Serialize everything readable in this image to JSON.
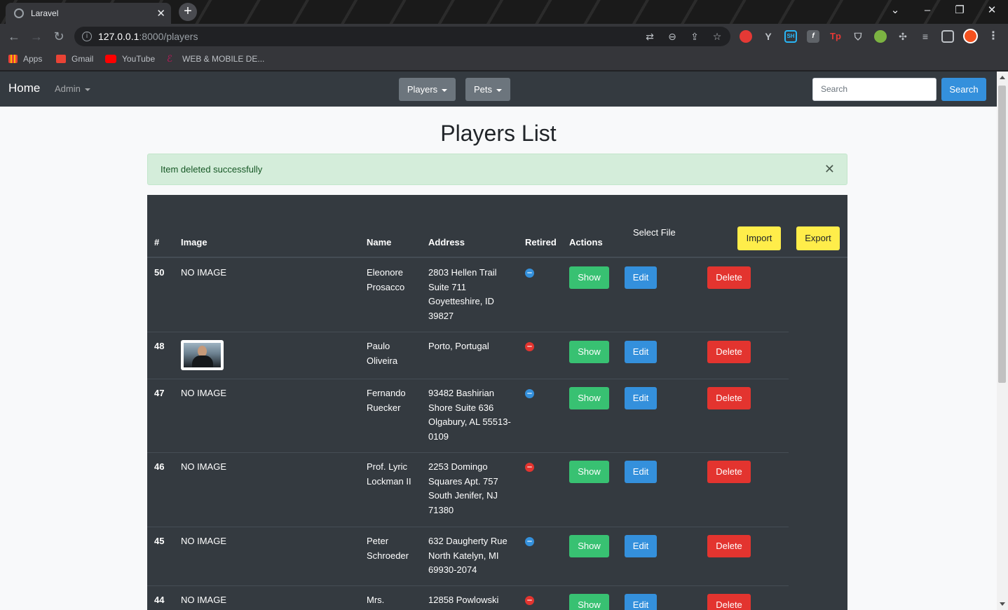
{
  "browser": {
    "tab_title": "Laravel",
    "tab_close": "✕",
    "new_tab": "+",
    "url_host": "127.0.0.1",
    "url_path": ":8000/players",
    "bookmarks": [
      "Apps",
      "Gmail",
      "YouTube",
      "WEB & MOBILE DE..."
    ]
  },
  "navbar": {
    "brand": "Home",
    "admin": "Admin",
    "players": "Players",
    "pets": "Pets",
    "search_placeholder": "Search",
    "search_button": "Search"
  },
  "page": {
    "title": "Players List",
    "alert": "Item deleted successfully",
    "alert_close": "✕"
  },
  "table": {
    "headers": {
      "id": "#",
      "image": "Image",
      "name": "Name",
      "address": "Address",
      "retired": "Retired",
      "actions": "Actions"
    },
    "select_file": "Select File",
    "import": "Import",
    "export": "Export",
    "actions": {
      "show": "Show",
      "edit": "Edit",
      "delete": "Delete"
    },
    "rows": [
      {
        "id": "50",
        "image": "NO IMAGE",
        "name": "Eleonore Prosacco",
        "address": "2803 Hellen Trail Suite 711 Goyetteshire, ID 39827",
        "retired": "blue"
      },
      {
        "id": "48",
        "image": "",
        "name": "Paulo Oliveira",
        "address": "Porto, Portugal",
        "retired": "red"
      },
      {
        "id": "47",
        "image": "NO IMAGE",
        "name": "Fernando Ruecker",
        "address": "93482 Bashirian Shore Suite 636 Olgabury, AL 55513-0109",
        "retired": "blue"
      },
      {
        "id": "46",
        "image": "NO IMAGE",
        "name": "Prof. Lyric Lockman II",
        "address": "2253 Domingo Squares Apt. 757 South Jenifer, NJ 71380",
        "retired": "red"
      },
      {
        "id": "45",
        "image": "NO IMAGE",
        "name": "Peter Schroeder",
        "address": "632 Daugherty Rue North Katelyn, MI 69930-2074",
        "retired": "blue"
      },
      {
        "id": "44",
        "image": "NO IMAGE",
        "name": "Mrs.",
        "address": "12858 Powlowski",
        "retired": "red"
      }
    ]
  },
  "colors": {
    "navbar": "#343a40",
    "table": "#343a40",
    "show": "#38c172",
    "edit": "#3490dc",
    "delete": "#e3342f",
    "import_export": "#ffed4a",
    "alert_bg": "#d4edda",
    "retired_yes": "#e3342f",
    "retired_no": "#3490dc"
  },
  "icons": [
    "globe-icon",
    "back-icon",
    "forward-icon",
    "reload-icon",
    "info-icon",
    "translate-icon",
    "zoom-icon",
    "share-icon",
    "star-icon",
    "extensions-icon",
    "profile-avatar",
    "menu-icon"
  ]
}
